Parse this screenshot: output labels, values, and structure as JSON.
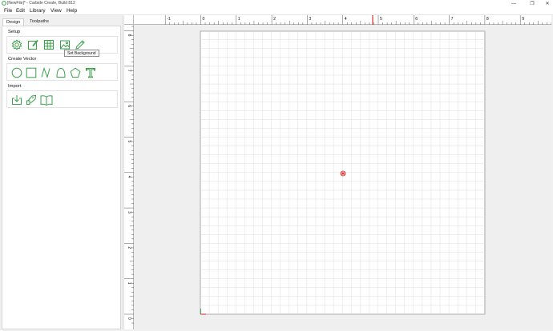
{
  "window": {
    "title": "[NewFile]* - Carbide Create, Build 812",
    "buttons": [
      "—",
      "❐",
      "✕"
    ]
  },
  "menu": [
    "File",
    "Edit",
    "Library",
    "View",
    "Help"
  ],
  "tabs": [
    {
      "label": "Design",
      "active": true
    },
    {
      "label": "Toolpaths",
      "active": false
    }
  ],
  "sections": {
    "setup": {
      "title": "Setup",
      "tools": [
        "gear-icon",
        "edit-document-icon",
        "grid-icon",
        "image-icon",
        "pencil-icon"
      ]
    },
    "create_vector": {
      "title": "Create Vector",
      "tools": [
        "circle-icon",
        "rectangle-icon",
        "polyline-icon",
        "curve-icon",
        "polygon-icon",
        "text-icon"
      ]
    },
    "import": {
      "title": "Import",
      "tools": [
        "import-icon",
        "bitmap-trace-icon",
        "book-icon"
      ]
    }
  },
  "tooltip": "Set Background",
  "ruler": {
    "x_labels": [
      "-1",
      "0",
      "1",
      "2",
      "3",
      "4",
      "5",
      "6",
      "7",
      "8",
      "9"
    ],
    "y_labels": [
      "8",
      "7",
      "6",
      "5",
      "4",
      "3",
      "2",
      "1",
      "0"
    ]
  },
  "colors": {
    "tool_green": "#3aa04a",
    "origin_red": "#e02020",
    "grid_line": "#dcdcdc",
    "cursor_marker": "#e03030"
  }
}
